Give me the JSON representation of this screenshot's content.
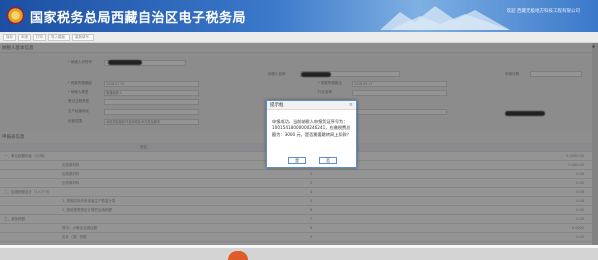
{
  "header": {
    "title": "国家税务总局西藏自治区电子税务局",
    "right_text": "欢迎 西藏无极地方科技工程有限公司"
  },
  "toolbar": {
    "buttons": [
      "保存",
      "申报",
      "打印",
      "导入模板",
      "重新填写"
    ]
  },
  "base_info": {
    "section_title": "纳税人基本信息",
    "fields": {
      "taxpayer_id_label": "* 纳税人识别号",
      "taxpayer_name_label": "纳税人名称",
      "tax_period_label": "申报日期",
      "period_start_label": "* 税款所属期起",
      "period_start_value": "2018-01-01",
      "period_end_label": "* 税款所属期止",
      "period_end_value": "2018-06-27",
      "bank_label": "* 纳税人类型",
      "bank_value": "普通纳税人",
      "industry_label": "行业名称",
      "register_type_label": "登记注册类型",
      "address_label": "生产经营地址",
      "contact_label": "联系电话",
      "scope_label": "经营范围",
      "scope_value": "消费类智能软件及网络技术开发及服务"
    }
  },
  "declare": {
    "section_title": "申报表信息",
    "header_item": "项目",
    "rows": [
      {
        "label": "一、单位税额标准（元/吨）",
        "num": "",
        "value": "0.0000.00"
      },
      {
        "label": "应税原材料",
        "num": "1",
        "value": "0.000.00"
      },
      {
        "label": "应税原材料",
        "num": "2",
        "value": "0.00"
      },
      {
        "label": "应税原材料",
        "num": "3",
        "value": "0.00"
      },
      {
        "label": "二、应纳税额合计（1+2+3）",
        "num": "4",
        "value": "0.00"
      },
      {
        "label": "1. 按照实际开采或者生产数量计算",
        "num": "5",
        "value": "0.00"
      },
      {
        "label": "2. 其他按照规定计算的应纳税额",
        "num": "6",
        "value": "0.00"
      },
      {
        "label": "三、减免税额",
        "num": "7",
        "value": "0.00"
      },
      {
        "label": "其中：小微企业减征额",
        "num": "8",
        "value": "0.0000"
      },
      {
        "label": "应补（退）税额",
        "num": "9",
        "value": "0.00"
      }
    ]
  },
  "dialog": {
    "title": "提示框",
    "close": "×",
    "message": "申报成功，当前纳税人申报凭证序号为：10015418000000246241，应缴税费总额为：3000 元，是否需要跳转网上扣款？",
    "ok_label": "是",
    "cancel_label": "否"
  },
  "colors": {
    "header_blue": "#1c4fa3",
    "dialog_border": "#5b8fd0"
  }
}
